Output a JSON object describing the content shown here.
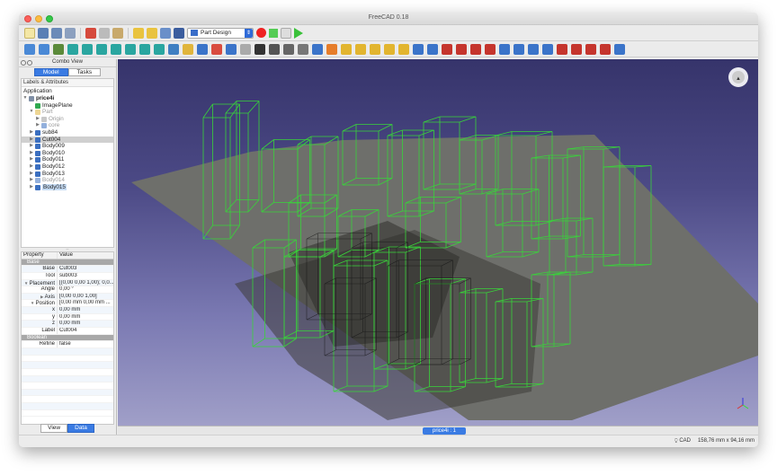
{
  "window": {
    "title": "FreeCAD 0.18"
  },
  "toolbar": {
    "workbench": "Part Design",
    "colors": {
      "accent": "#3a7be3",
      "record": "#e22222",
      "stop": "#55cc55",
      "play": "#3ac13a"
    }
  },
  "combo": {
    "title": "Combo View",
    "tabs": [
      "Model",
      "Tasks"
    ],
    "labels_header": "Labels & Attributes",
    "application_label": "Application"
  },
  "tree": [
    {
      "label": "price4i",
      "level": 0,
      "expanded": true,
      "icon": "document-icon",
      "bold": true
    },
    {
      "label": "ImagePlane",
      "level": 1,
      "icon": "image-plane-icon"
    },
    {
      "label": "Part",
      "level": 1,
      "expanded": true,
      "icon": "part-icon",
      "gray": true
    },
    {
      "label": "Origin",
      "level": 2,
      "collapsed": true,
      "icon": "origin-icon",
      "gray": true
    },
    {
      "label": "core",
      "level": 2,
      "collapsed": true,
      "icon": "body-icon",
      "gray": true
    },
    {
      "label": "sub84",
      "level": 1,
      "collapsed": true,
      "icon": "body-icon"
    },
    {
      "label": "Cut004",
      "level": 1,
      "collapsed": true,
      "icon": "cut-icon",
      "selected": true
    },
    {
      "label": "Body009",
      "level": 1,
      "collapsed": true,
      "icon": "body-icon"
    },
    {
      "label": "Body010",
      "level": 1,
      "collapsed": true,
      "icon": "body-icon"
    },
    {
      "label": "Body011",
      "level": 1,
      "collapsed": true,
      "icon": "body-icon"
    },
    {
      "label": "Body012",
      "level": 1,
      "collapsed": true,
      "icon": "body-icon"
    },
    {
      "label": "Body013",
      "level": 1,
      "collapsed": true,
      "icon": "body-icon"
    },
    {
      "label": "Body014",
      "level": 1,
      "collapsed": true,
      "icon": "body-icon",
      "gray": true
    },
    {
      "label": "Body015",
      "level": 1,
      "collapsed": true,
      "icon": "body-icon",
      "highlight": true
    }
  ],
  "properties": {
    "header": [
      "Property",
      "Value"
    ],
    "rows": [
      {
        "key": "Base",
        "value": "",
        "group": true
      },
      {
        "key": "Base",
        "value": "Cut003"
      },
      {
        "key": "Tool",
        "value": "sub003"
      },
      {
        "key": "Placement",
        "value": "[(0,00 0,00 1,00); 0,0...",
        "expand": "▼"
      },
      {
        "key": "Angle",
        "value": "0,00 °"
      },
      {
        "key": "Axis",
        "value": "[0,00 0,00 1,00]",
        "expand": "▶"
      },
      {
        "key": "Position",
        "value": "[0,00 mm  0,00 mm  ...",
        "expand": "▼"
      },
      {
        "key": "x",
        "value": "0,00 mm"
      },
      {
        "key": "y",
        "value": "0,00 mm"
      },
      {
        "key": "z",
        "value": "0,00 mm"
      },
      {
        "key": "Label",
        "value": "Cut004"
      },
      {
        "key": "Boolean",
        "value": "",
        "group": true
      },
      {
        "key": "Refine",
        "value": "false"
      }
    ]
  },
  "bottom_tabs": [
    "View",
    "Data"
  ],
  "document_tab": "price4i : 1",
  "status": {
    "nav_style": "CAD",
    "dimensions": "158,76 mm x 94,16 mm"
  }
}
